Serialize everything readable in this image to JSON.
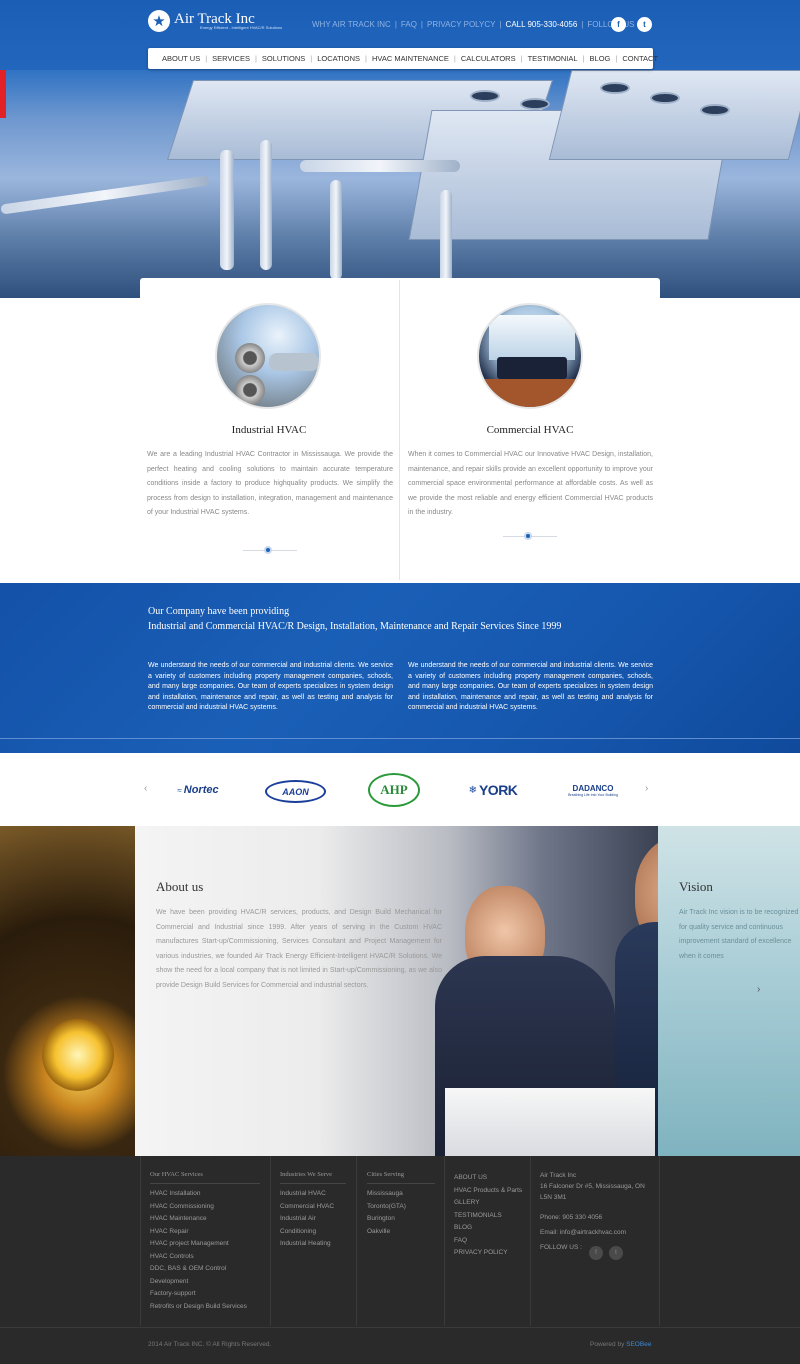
{
  "brand": {
    "name": "Air Track Inc",
    "tagline": "Energy Efficient - Intelligent HVAC/R Solutions"
  },
  "topnav": {
    "why": "WHY AIR TRACK INC",
    "faq": "FAQ",
    "privacy": "PRIVACY POLYCY",
    "call": "CALL 905-330-4056",
    "follow": "FOLLOW US"
  },
  "social": {
    "facebook_icon": "f",
    "twitter_icon": "t"
  },
  "mainnav": [
    "ABOUT US",
    "SERVICES",
    "SOLUTIONS",
    "LOCATIONS",
    "HVAC MAINTENANCE",
    "CALCULATORS",
    "TESTIMONIAL",
    "BLOG",
    "CONTACT"
  ],
  "services": [
    {
      "title": "Industrial HVAC",
      "text": "We are a leading Industrial HVAC Contractor in Mississauga. We provide the perfect heating and cooling solutions to maintain accurate temperature conditions inside a factory to produce highquality products. We simplify the process from design to installation, integration, management and maintenance of your Industrial HVAC systems."
    },
    {
      "title": "Commercial HVAC",
      "text": "When it comes to Commercial HVAC our Innovative HVAC Design, installation, maintenance, and repair skills provide an excellent opportunity to improve your commercial space environmental performance at affordable costs. As well as we provide the most reliable and energy efficient Commercial HVAC products in the industry."
    }
  ],
  "band": {
    "line1": "Our Company have been providing",
    "line2": "Industrial and Commercial HVAC/R Design, Installation, Maintenance and Repair Services Since 1999",
    "col1": "We understand the needs of our commercial and industrial clients. We service a variety of customers including property management companies, schools, and many large companies. Our team of experts specializes in system design and installation, maintenance and repair, as well as testing and analysis for commercial and industrial HVAC systems.",
    "col2": "We understand the needs of our commercial and industrial clients. We service a variety of customers including property management companies, schools, and many large companies. Our team of experts specializes in system design and installation, maintenance and repair, as well as testing and analysis for commercial and industrial HVAC systems."
  },
  "brands": {
    "prev": "‹",
    "next": "›",
    "nortec": "Nortec",
    "aaon": "AAON",
    "ahp": "AHP",
    "york": "YORK",
    "dadanco": "DADANCO",
    "dadanco_tag": "Breathing Life Into Your Building"
  },
  "about": {
    "title": "About us",
    "text": "We have been providing HVAC/R services, products, and Design Build Mechanical for Commercial and Industrial since 1999. After years of serving in the Custom HVAC manufactures Start-up/Commissioning, Services Consultant and Project Management for various industries, we founded Air Track Energy Efficient-Intelligent HVAC/R Solutions. We show the need for a local company that is not limited in Start-up/Commissioning, as we also provide Design Build Services for Commercial and industrial sectors.",
    "vision_title": "Vision",
    "vision_text": "Air Track Inc vision is to be recognized for quality service and continuous improvement standard of excellence when it comes",
    "vision_arrow": "›"
  },
  "footer": {
    "col1": {
      "title": "Our HVAC Services",
      "items": [
        "HVAC Installation",
        "HVAC Commissioning",
        "HVAC Maintenance",
        "HVAC Repair",
        "HVAC project Management",
        "HVAC Controls",
        "DDC, BAS & OEM Control",
        "Development",
        "Factory-support",
        "Retrofits or Design Build Services"
      ]
    },
    "col2": {
      "title": "Industries We Serve",
      "items": [
        "Industrial HVAC",
        "Commercial HVAC",
        "Industrial Air",
        "Conditioning",
        "Industrial Heating"
      ]
    },
    "col3": {
      "title": "Cities Serving",
      "items": [
        "Mississauga",
        "Toronto(GTA)",
        "Burington",
        "Oakville"
      ]
    },
    "col4": {
      "items": [
        "ABOUT US",
        "HVAC Products & Parts",
        "GLLERY",
        "TESTIMONIALS",
        "BLOG",
        "FAQ",
        "PRIVACY POLICY"
      ]
    },
    "col5": {
      "company": "Air Track Inc",
      "address1": "16 Falconer Dr #5, Mississauga, ON",
      "address2": "L5N 3M1",
      "phone": "Phone: 905 330 4056",
      "email": "Email: info@airtrackhvac.com",
      "follow": "FOLLOW US :",
      "fb": "f",
      "tw": "t"
    },
    "copyright": "2014 Air Track INC. © All Rights Reserved.",
    "powered_prefix": "Powered by",
    "powered_brand": "SEOBee"
  }
}
